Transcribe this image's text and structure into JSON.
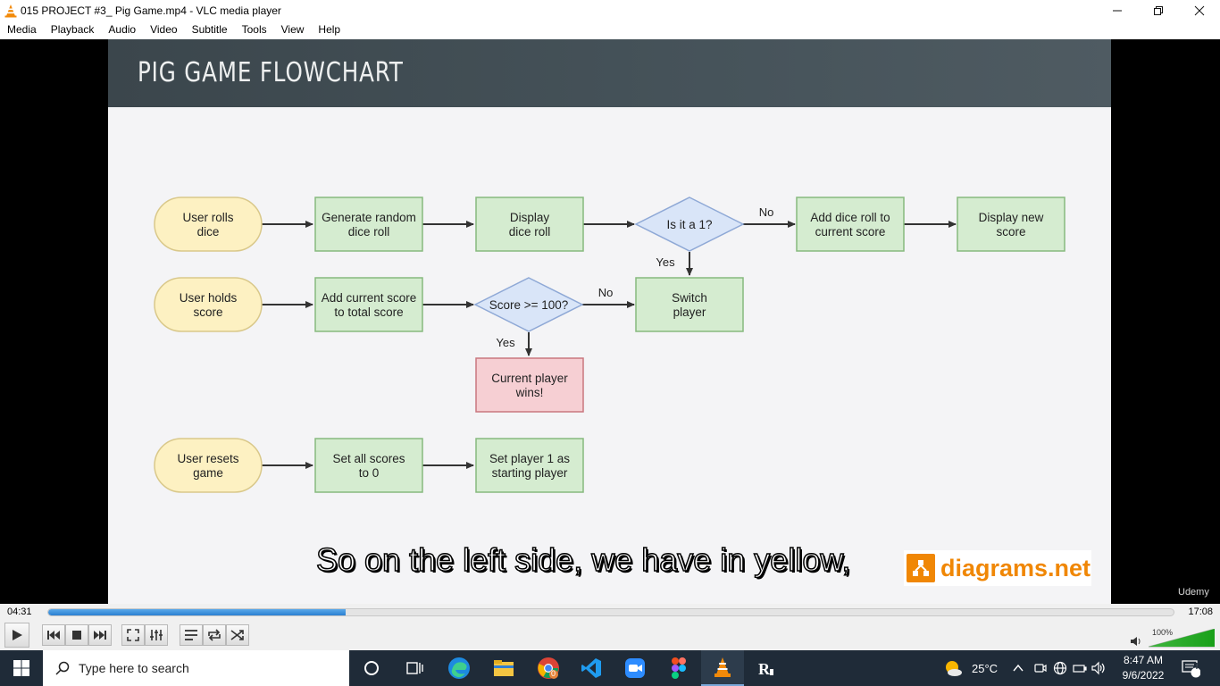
{
  "window": {
    "title": "015 PROJECT #3_ Pig Game.mp4 - VLC media player"
  },
  "menu": [
    "Media",
    "Playback",
    "Audio",
    "Video",
    "Subtitle",
    "Tools",
    "View",
    "Help"
  ],
  "slide": {
    "title": "PIG GAME FLOWCHART",
    "subtitle_caption": "So on the left side, we have in yellow,",
    "badge_text": "diagrams.net",
    "watermark": "Udemy"
  },
  "flowchart": {
    "nodes": {
      "user_rolls": [
        "User rolls",
        "dice"
      ],
      "generate": [
        "Generate random",
        "dice roll"
      ],
      "display_dice": [
        "Display",
        "dice roll"
      ],
      "is_it_1": [
        "Is it a 1?"
      ],
      "add_roll": [
        "Add dice roll to",
        "current score"
      ],
      "display_score": [
        "Display new",
        "score"
      ],
      "user_holds": [
        "User holds",
        "score"
      ],
      "add_current": [
        "Add current score",
        "to total score"
      ],
      "score_check": [
        "Score >= 100?"
      ],
      "switch_player": [
        "Switch",
        "player"
      ],
      "player_wins": [
        "Current player",
        "wins!"
      ],
      "user_resets": [
        "User resets",
        "game"
      ],
      "set_scores": [
        "Set all scores",
        "to 0"
      ],
      "set_player": [
        "Set player 1 as",
        "starting player"
      ]
    },
    "edge_labels": {
      "no1": "No",
      "yes1": "Yes",
      "no2": "No",
      "yes2": "Yes"
    },
    "colors": {
      "yellow": "#fdf1c2",
      "yellow_border": "#d9c88a",
      "green": "#d5ecd0",
      "green_border": "#86b97e",
      "blue": "#d9e5f8",
      "blue_border": "#8fa9d6",
      "red": "#f6cfd3",
      "red_border": "#c9777f"
    }
  },
  "player": {
    "time_current": "04:31",
    "time_total": "17:08",
    "progress": 0.264,
    "volume_label": "100%",
    "volume": 1.0
  },
  "taskbar": {
    "search_placeholder": "Type here to search",
    "weather": "25°C",
    "time": "8:47 AM",
    "date": "9/6/2022",
    "notifications": "4",
    "chrome_badge": "0"
  }
}
